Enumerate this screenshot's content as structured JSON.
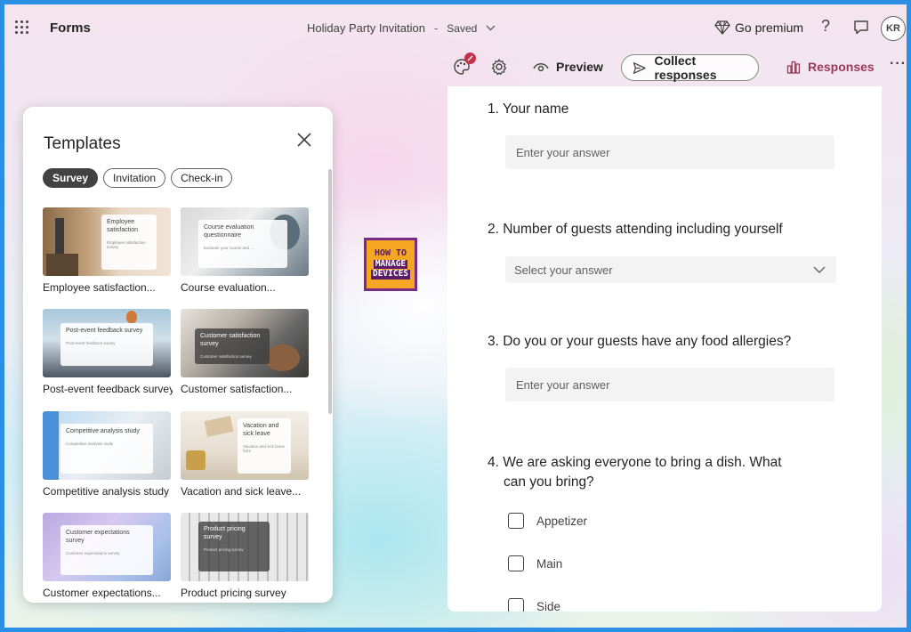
{
  "header": {
    "app_name": "Forms",
    "doc_title": "Holiday Party Invitation",
    "separator": "-",
    "status": "Saved",
    "premium_label": "Go premium",
    "help_label": "?",
    "avatar_initials": "KR"
  },
  "toolbar": {
    "theme_badge": "",
    "preview_label": "Preview",
    "collect_label": "Collect responses",
    "responses_label": "Responses",
    "more_label": "···"
  },
  "templates": {
    "title": "Templates",
    "filters": [
      "Survey",
      "Invitation",
      "Check-in"
    ],
    "active_filter": "Survey",
    "items": [
      {
        "label": "Employee satisfaction...",
        "card_title": "Employee satisfaction",
        "card_sub": "Employee satisfaction survey"
      },
      {
        "label": "Course evaluation...",
        "card_title": "Course evaluation questionnaire",
        "card_sub": "Evaluate your course and ..."
      },
      {
        "label": "Post-event feedback survey",
        "card_title": "Post-event feedback survey",
        "card_sub": "Post-event feedback survey"
      },
      {
        "label": "Customer satisfaction...",
        "card_title": "Customer satisfaction survey",
        "card_sub": "Customer satisfaction survey"
      },
      {
        "label": "Competitive analysis study",
        "card_title": "Competitive analysis study",
        "card_sub": "Competitive analysis study"
      },
      {
        "label": "Vacation and sick leave...",
        "card_title": "Vacation and sick leave",
        "card_sub": "Vacation and sick leave form"
      },
      {
        "label": "Customer expectations...",
        "card_title": "Customer expectations survey",
        "card_sub": "Customer expectations survey"
      },
      {
        "label": "Product pricing survey",
        "card_title": "Product pricing survey",
        "card_sub": "Product pricing survey"
      }
    ]
  },
  "logo": {
    "line1": "HOW TO",
    "line2": "MANAGE",
    "line3": "DEVICES"
  },
  "form": {
    "q1": {
      "label": "1. Your name",
      "placeholder": "Enter your answer"
    },
    "q2": {
      "label": "2. Number of guests attending including yourself",
      "placeholder": "Select your answer"
    },
    "q3": {
      "label": "3. Do you or your guests have any food allergies?",
      "placeholder": "Enter your answer"
    },
    "q4": {
      "label_line1": "4. We are asking everyone to bring a dish. What",
      "label_line2": "can you bring?",
      "options": [
        "Appetizer",
        "Main",
        "Side"
      ]
    }
  },
  "colors": {
    "frame_border": "#2b8fe6",
    "responses_accent": "#9a3a5a",
    "badge": "#c4314b",
    "logo_purple": "#7a2b87",
    "logo_orange": "#f5a623"
  }
}
